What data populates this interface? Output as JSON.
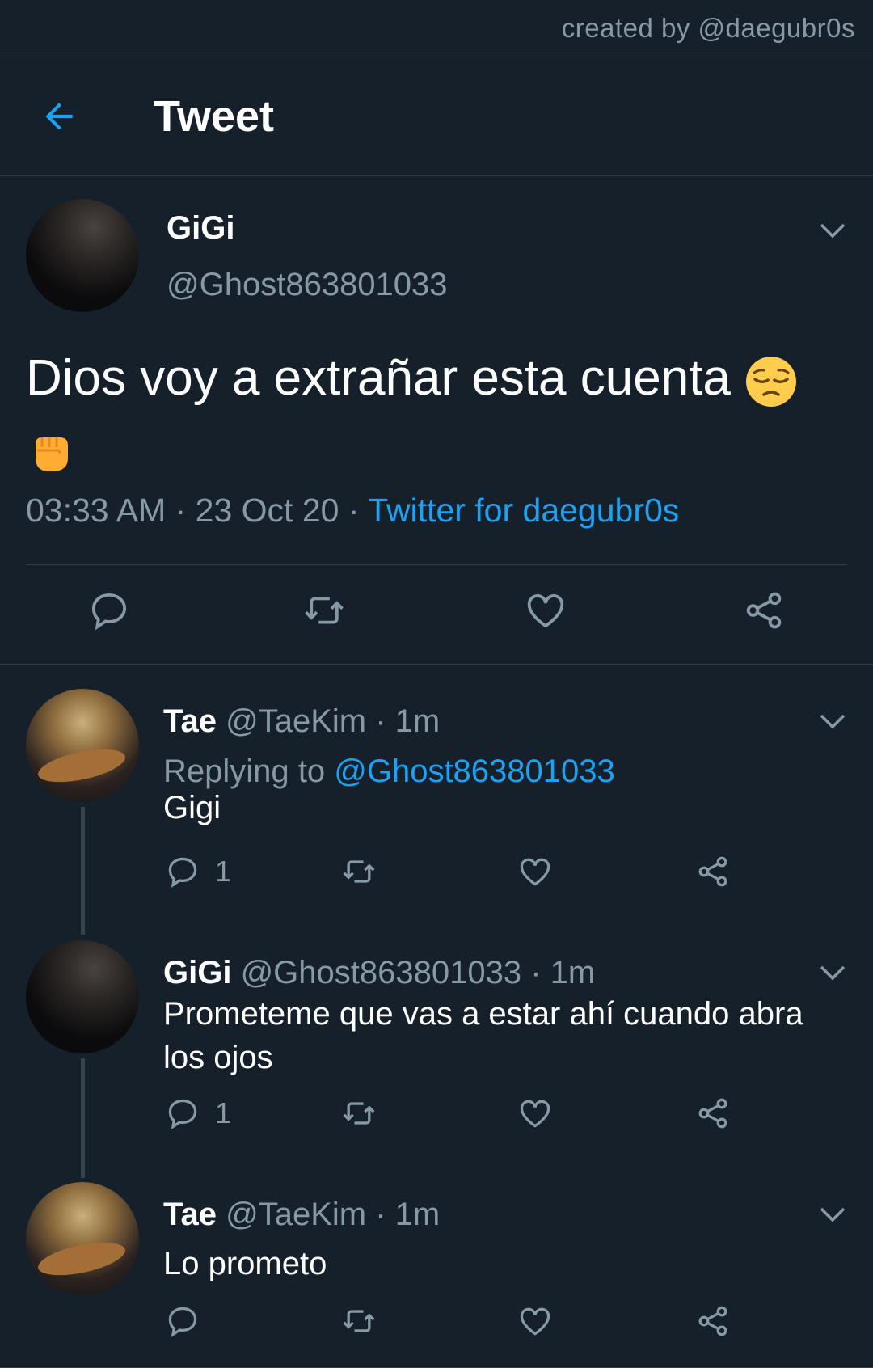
{
  "credit": "created by @daegubr0s",
  "header": {
    "title": "Tweet"
  },
  "main_tweet": {
    "name": "GiGi",
    "handle": "@Ghost863801033",
    "text": "Dios voy a extrañar esta cuenta",
    "emojis": [
      "pensive-face",
      "raised-fist"
    ],
    "time": "03:33 AM",
    "dot1": " · ",
    "date": "23 Oct 20",
    "dot2": " · ",
    "source": "Twitter for daegubr0s"
  },
  "replies": [
    {
      "name": "Tae",
      "handle": "@TaeKim",
      "time": " · 1m",
      "replying_prefix": "Replying to ",
      "replying_to": "@Ghost863801033",
      "text": "Gigi",
      "reply_count": "1"
    },
    {
      "name": "GiGi",
      "handle": "@Ghost863801033",
      "time": " · 1m",
      "text": "Prometeme que vas a estar ahí cuando abra los ojos",
      "reply_count": "1"
    },
    {
      "name": "Tae",
      "handle": "@TaeKim",
      "time": " · 1m",
      "text": "Lo prometo",
      "reply_count": ""
    }
  ],
  "colors": {
    "background": "#15202b",
    "accent": "#1da1f2",
    "muted": "#8899a6",
    "border": "#2f3d4a"
  },
  "icons": [
    "back-arrow-icon",
    "chevron-down-icon",
    "reply-icon",
    "retweet-icon",
    "like-icon",
    "share-icon"
  ]
}
